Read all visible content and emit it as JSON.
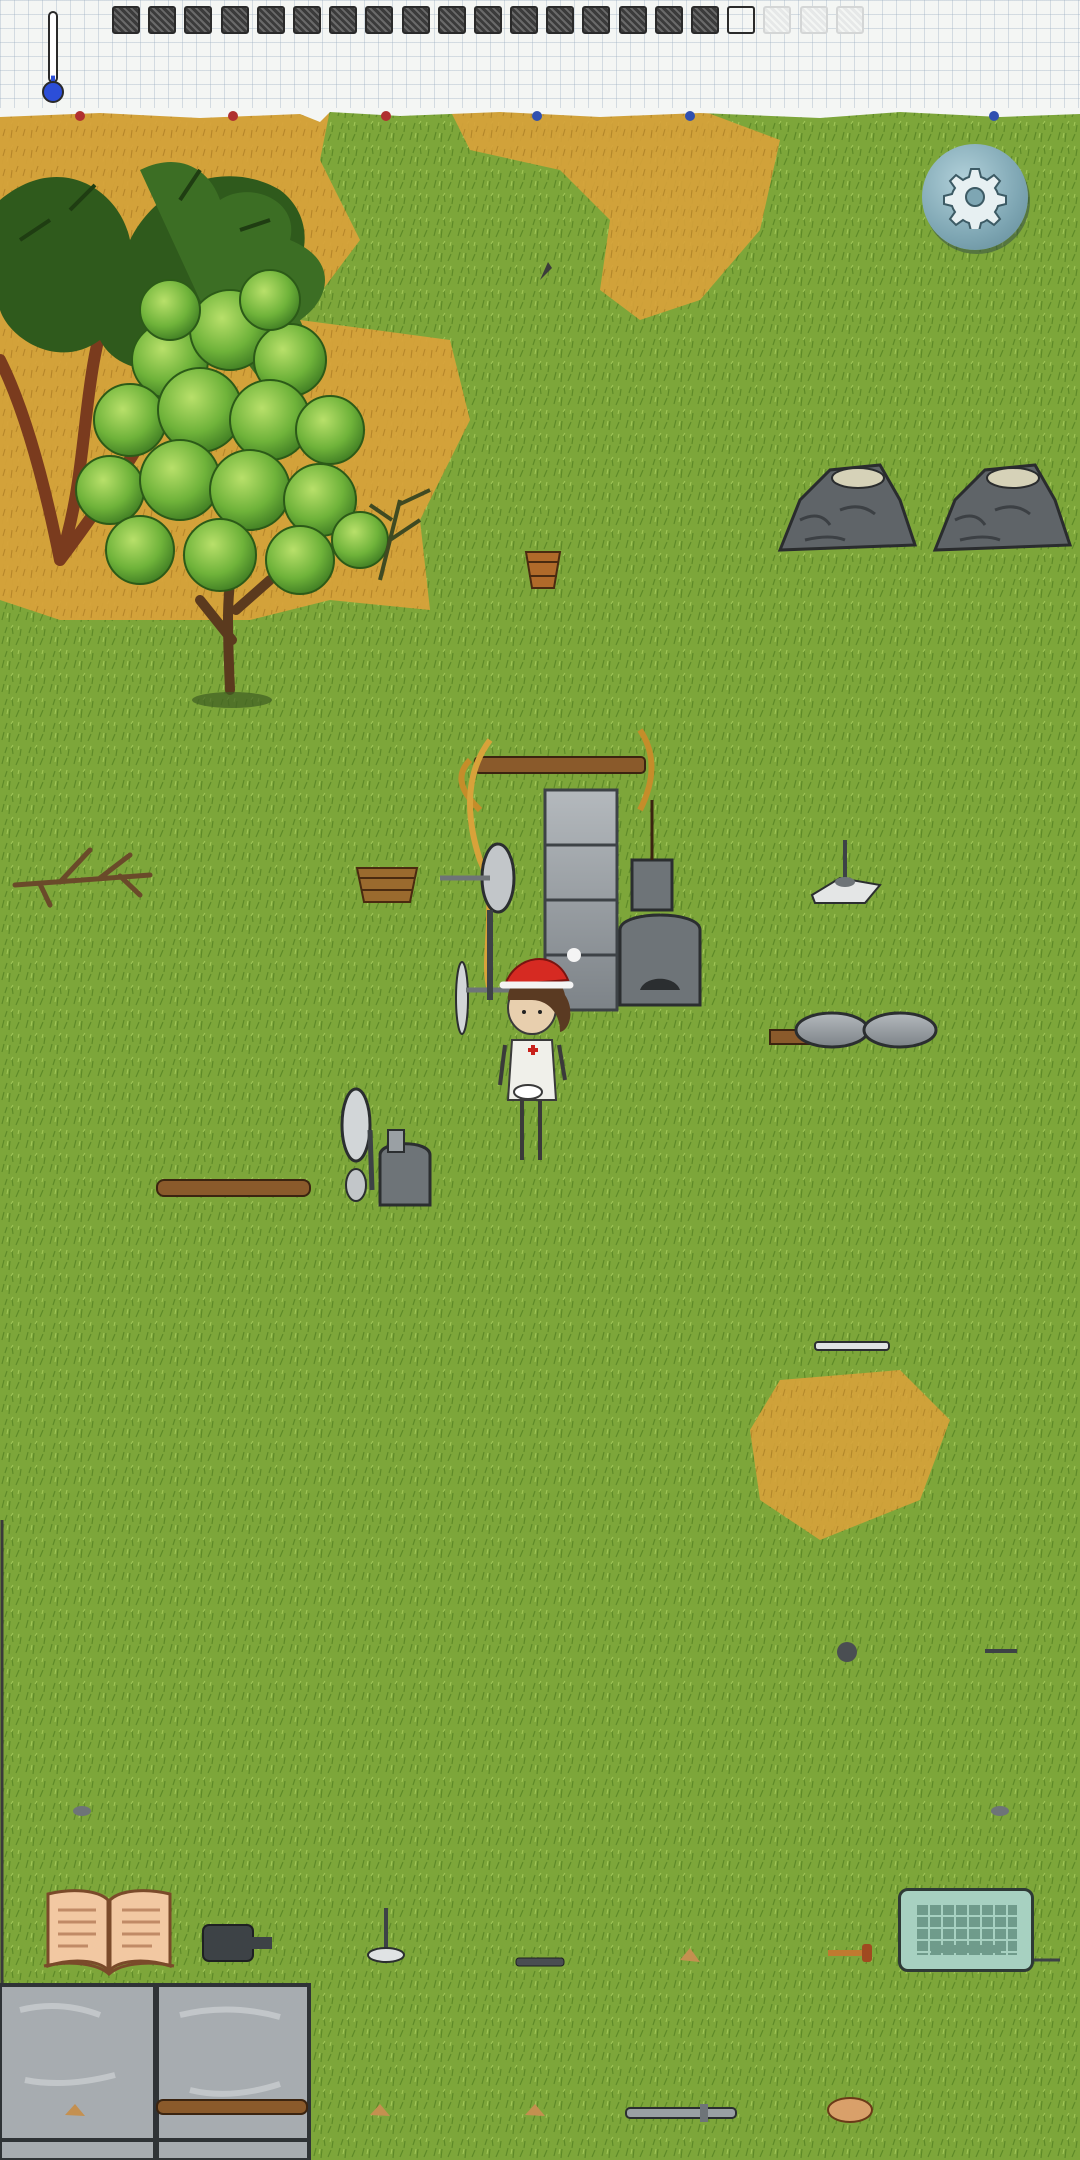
{
  "game": {
    "hud": {
      "temperature_icon": "thermometer-icon",
      "food_pips_full": 17,
      "food_pips_empty": 1,
      "food_pips_faded": 3,
      "temperature_level": 0.12
    },
    "buttons": {
      "settings_icon": "gear-icon",
      "recipe_book_icon": "open-book-icon",
      "chat_keyboard_icon": "keyboard-icon"
    },
    "player": {
      "hat": "santa-hat",
      "apron": "red-cross-apron"
    },
    "colors": {
      "grass": "#7da63a",
      "dry_grass": "#d8a23a",
      "stone": "#9aa0a4",
      "wood": "#8a5a2b",
      "settings_button": "#7ea6b3",
      "keyboard_button": "#a7d1c1"
    }
  }
}
